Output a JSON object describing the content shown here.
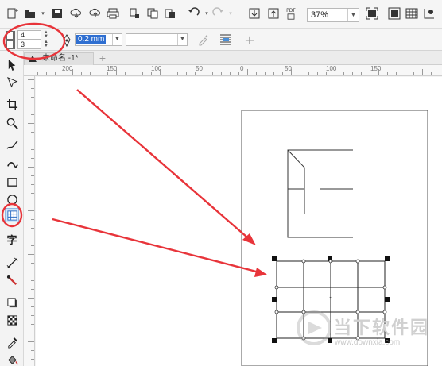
{
  "toolbar": {
    "zoom_value": "37%",
    "pdf_label": "PDF"
  },
  "table_tool_props": {
    "rows_value": "4",
    "columns_value": "3",
    "outline_width": "0.2 mm"
  },
  "document": {
    "tab_label": "未命名 -1*"
  },
  "ruler": {
    "h_labels": [
      "200",
      "150",
      "100",
      "50",
      "0",
      "50",
      "100",
      "150"
    ]
  },
  "watermark": {
    "brand_text": "当下软件园",
    "url_text": "www.downxia.com"
  },
  "annotation": {
    "highlight_color": "#e8343a"
  }
}
